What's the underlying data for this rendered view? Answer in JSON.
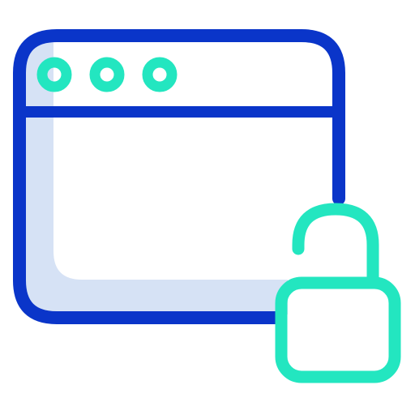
{
  "icon": {
    "name": "unlocked-browser-window-icon",
    "parts": {
      "window": "browser-window-icon",
      "dots": "window-control-dots",
      "lock": "unlocked-padlock-icon"
    }
  },
  "colors": {
    "window_stroke": "#0a35c9",
    "window_shadow_fill": "#d6e2f5",
    "accent": "#23e6c0",
    "background": "#ffffff"
  }
}
